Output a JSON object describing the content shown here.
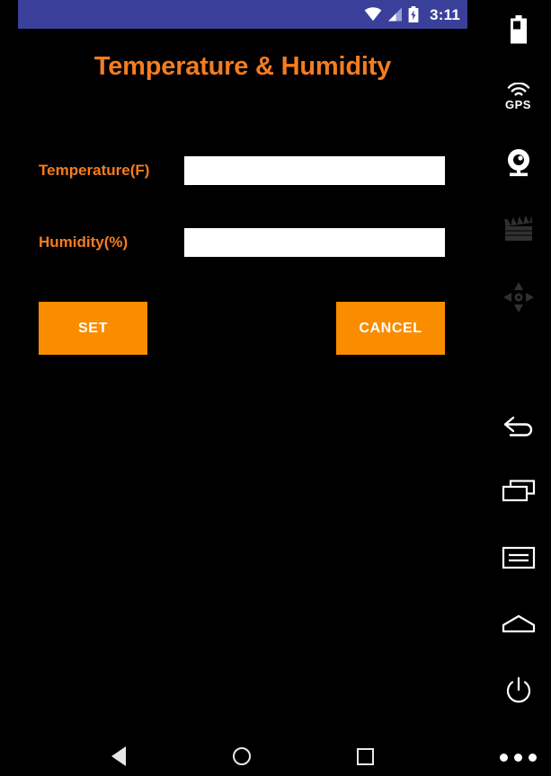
{
  "status_bar": {
    "time": "3:11",
    "icons": [
      "wifi-icon",
      "cellular-signal-icon",
      "battery-charging-icon"
    ],
    "background_color": "#3a409a"
  },
  "app": {
    "title": "Temperature & Humidity",
    "title_color": "#f57c1f",
    "background_color": "#000000",
    "fields": [
      {
        "label": "Temperature(F)",
        "value": "",
        "placeholder": ""
      },
      {
        "label": "Humidity(%)",
        "value": "",
        "placeholder": ""
      }
    ],
    "buttons": {
      "set_label": "SET",
      "cancel_label": "CANCEL",
      "color": "#fa8c00",
      "text_color": "#ffffff"
    }
  },
  "nav_bar": {
    "back_label": "Back",
    "home_label": "Home",
    "recents_label": "Recents"
  },
  "emulator_toolbar": {
    "items": [
      {
        "name": "battery-icon",
        "label": "Battery",
        "enabled": true
      },
      {
        "name": "gps-icon",
        "label": "GPS",
        "enabled": true
      },
      {
        "name": "webcam-icon",
        "label": "Webcam",
        "enabled": true
      },
      {
        "name": "clapperboard-record-icon",
        "label": "Record",
        "enabled": false
      },
      {
        "name": "dpad-icon",
        "label": "D-Pad",
        "enabled": false
      },
      {
        "name": "back-arrow-icon",
        "label": "Back",
        "enabled": true
      },
      {
        "name": "overview-windows-icon",
        "label": "Overview",
        "enabled": true
      },
      {
        "name": "menu-icon",
        "label": "Menu",
        "enabled": true
      },
      {
        "name": "home-icon",
        "label": "Home",
        "enabled": true
      },
      {
        "name": "power-icon",
        "label": "Power",
        "enabled": true
      },
      {
        "name": "more-icon",
        "label": "More",
        "enabled": true
      }
    ]
  }
}
